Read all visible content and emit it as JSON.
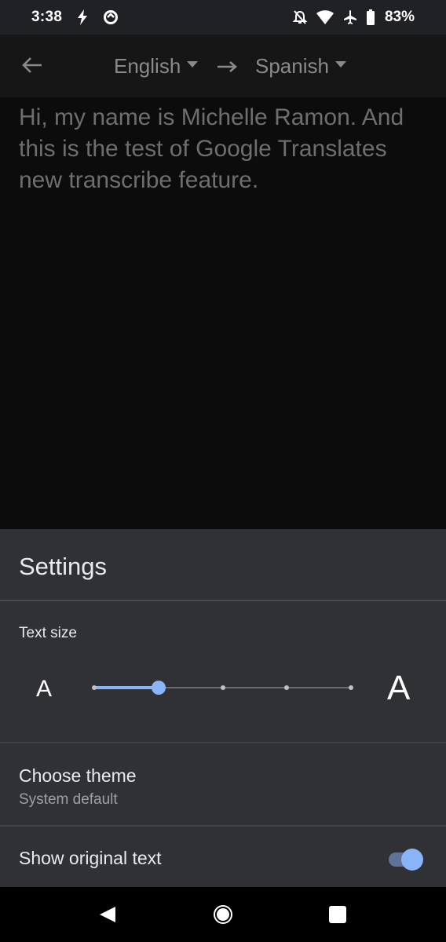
{
  "status_bar": {
    "time": "3:38",
    "battery": "83%",
    "icons": [
      "charging-bolt-icon",
      "data-saver-icon",
      "notifications-off-icon",
      "wifi-icon",
      "airplane-mode-icon",
      "battery-icon"
    ]
  },
  "app_bar": {
    "source_language": "English",
    "target_language": "Spanish",
    "back_icon": "arrow-left-icon",
    "swap_icon": "arrow-right-icon"
  },
  "transcript": {
    "text": "Hi, my name is Michelle Ramon. And this is the test of Google Translates new transcribe feature."
  },
  "settings": {
    "title": "Settings",
    "text_size": {
      "label": "Text size",
      "small_glyph": "A",
      "large_glyph": "A",
      "steps": 5,
      "selected_step": 2
    },
    "theme": {
      "title": "Choose theme",
      "value": "System default"
    },
    "show_original": {
      "label": "Show original text",
      "enabled": true
    }
  },
  "colors": {
    "accent": "#8ab4f8",
    "sheet_background": "#303134",
    "transcript_text": "#6e6e6e"
  },
  "nav_bar": {
    "icons": [
      "nav-back-icon",
      "nav-home-icon",
      "nav-recents-icon"
    ]
  }
}
